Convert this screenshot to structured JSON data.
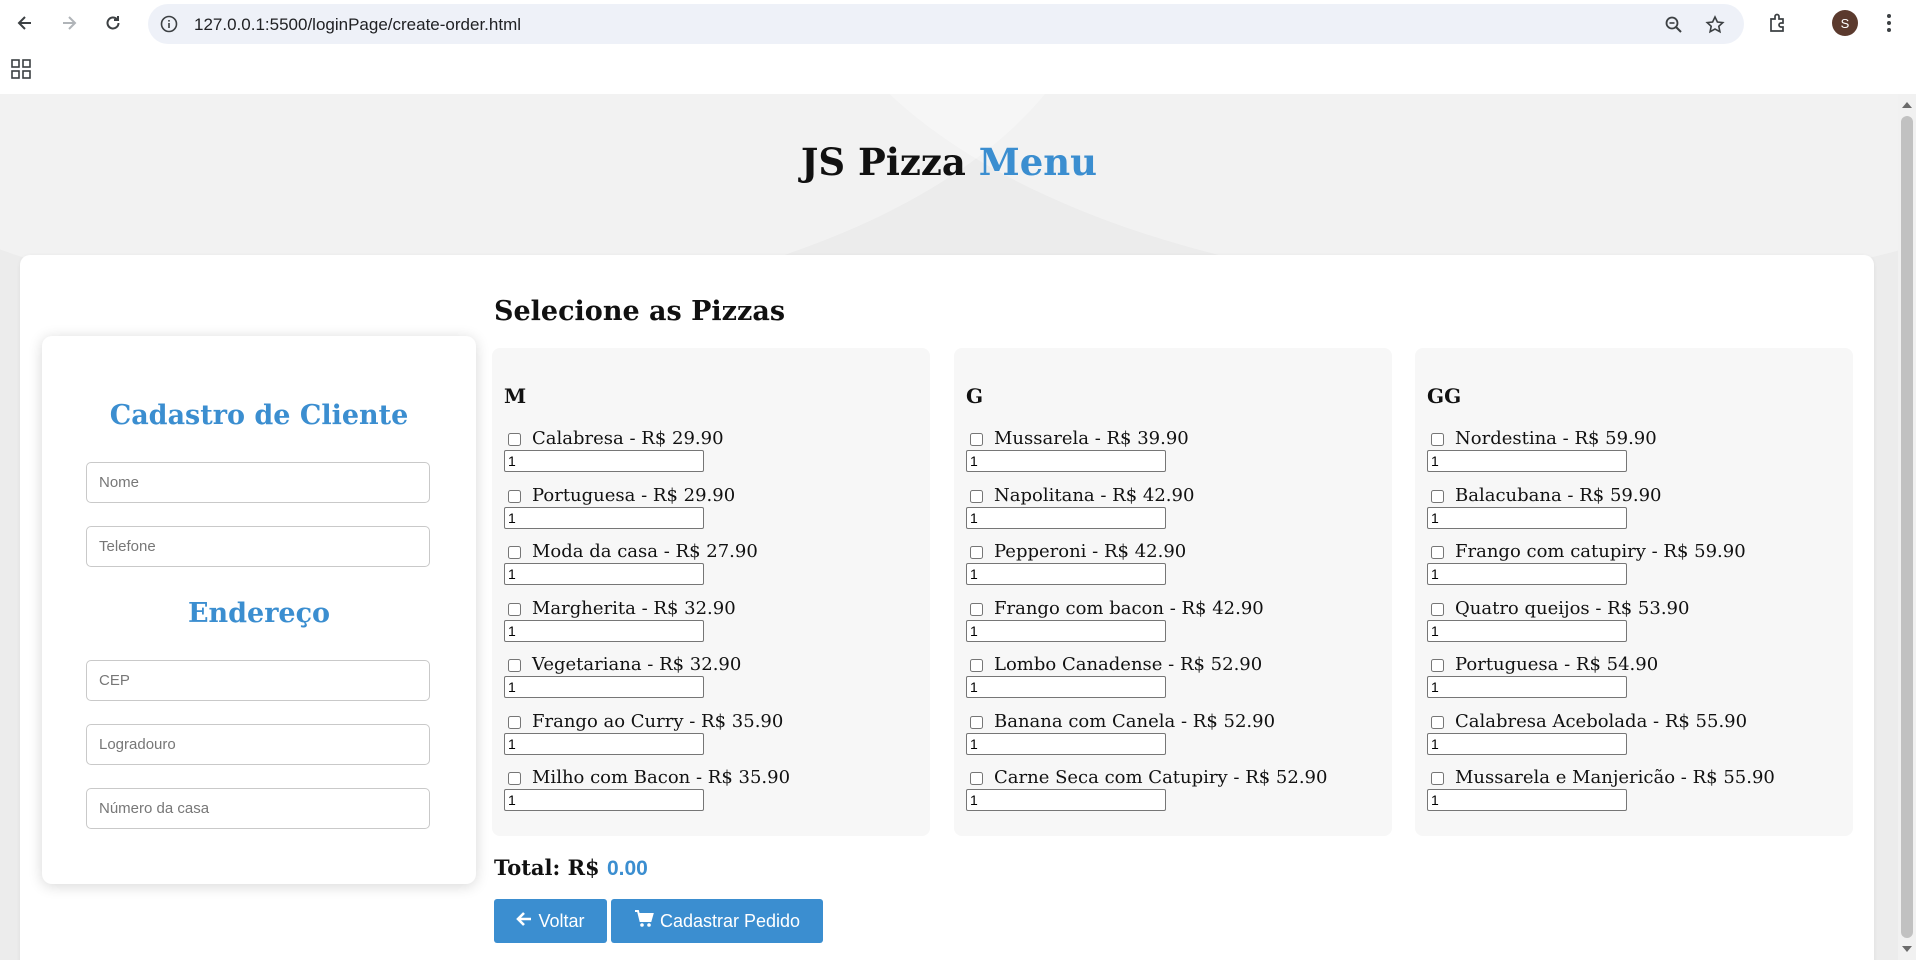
{
  "browser": {
    "url": "127.0.0.1:5500/loginPage/create-order.html",
    "avatar_letter": "S"
  },
  "page": {
    "title_main": "JS Pizza",
    "title_accent": "Menu",
    "accent_color": "#3b8ed0"
  },
  "client": {
    "heading": "Cadastro de Cliente",
    "name_placeholder": "Nome",
    "phone_placeholder": "Telefone",
    "address_heading": "Endereço",
    "cep_placeholder": "CEP",
    "street_placeholder": "Logradouro",
    "number_placeholder": "Número da casa"
  },
  "menu": {
    "section_title": "Selecione as Pizzas",
    "sizes": [
      {
        "label": "M",
        "pizzas": [
          {
            "label": "Calabresa - R$ 29.90",
            "qty": "1"
          },
          {
            "label": "Portuguesa - R$ 29.90",
            "qty": "1"
          },
          {
            "label": "Moda da casa - R$ 27.90",
            "qty": "1"
          },
          {
            "label": "Margherita - R$ 32.90",
            "qty": "1"
          },
          {
            "label": "Vegetariana - R$ 32.90",
            "qty": "1"
          },
          {
            "label": "Frango ao Curry - R$ 35.90",
            "qty": "1"
          },
          {
            "label": "Milho com Bacon - R$ 35.90",
            "qty": "1"
          }
        ]
      },
      {
        "label": "G",
        "pizzas": [
          {
            "label": "Mussarela - R$ 39.90",
            "qty": "1"
          },
          {
            "label": "Napolitana - R$ 42.90",
            "qty": "1"
          },
          {
            "label": "Pepperoni - R$ 42.90",
            "qty": "1"
          },
          {
            "label": "Frango com bacon - R$ 42.90",
            "qty": "1"
          },
          {
            "label": "Lombo Canadense - R$ 52.90",
            "qty": "1"
          },
          {
            "label": "Banana com Canela - R$ 52.90",
            "qty": "1"
          },
          {
            "label": "Carne Seca com Catupiry - R$ 52.90",
            "qty": "1"
          }
        ]
      },
      {
        "label": "GG",
        "pizzas": [
          {
            "label": "Nordestina - R$ 59.90",
            "qty": "1"
          },
          {
            "label": "Balacubana - R$ 59.90",
            "qty": "1"
          },
          {
            "label": "Frango com catupiry - R$ 59.90",
            "qty": "1"
          },
          {
            "label": "Quatro queijos - R$ 53.90",
            "qty": "1"
          },
          {
            "label": "Portuguesa - R$ 54.90",
            "qty": "1"
          },
          {
            "label": "Calabresa Acebolada - R$ 55.90",
            "qty": "1"
          },
          {
            "label": "Mussarela e Manjericão - R$ 55.90",
            "qty": "1"
          }
        ]
      }
    ],
    "total_label": "Total: R$",
    "total_value": "0.00"
  },
  "actions": {
    "back_label": "Voltar",
    "submit_label": "Cadastrar Pedido"
  }
}
